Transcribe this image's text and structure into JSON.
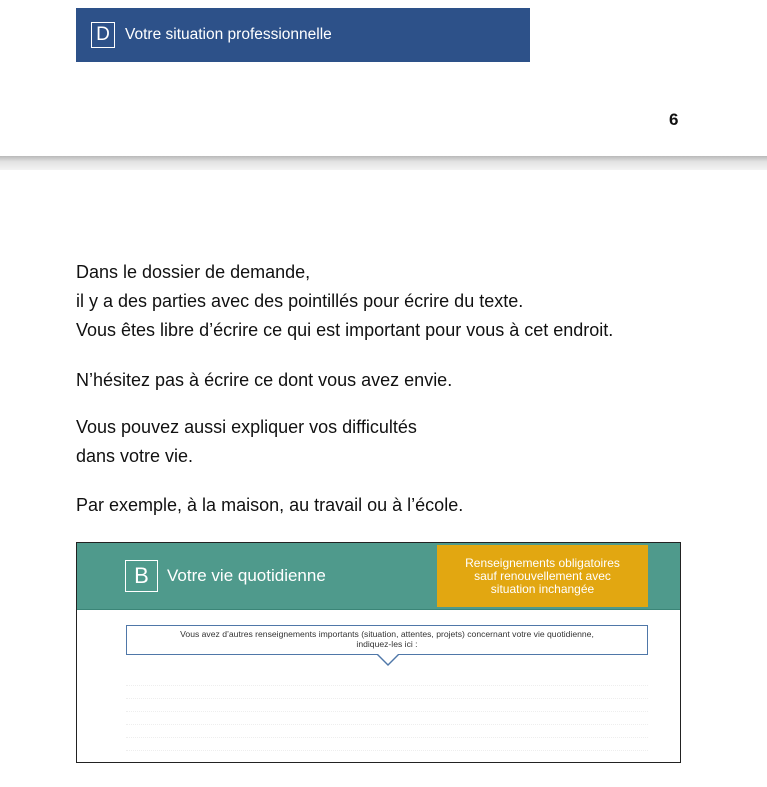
{
  "section_d": {
    "letter": "D",
    "title": "Votre situation professionnelle"
  },
  "page_number": "6",
  "body": {
    "paragraph_1": [
      "Dans le dossier de demande,",
      "il y a des parties avec des pointillés pour écrire du texte.",
      "Vous êtes libre d’écrire ce qui est important pour vous à cet endroit."
    ],
    "paragraph_2": "N’hésitez pas à écrire ce dont vous avez envie.",
    "paragraph_3": [
      "Vous pouvez aussi expliquer vos difficultés",
      "dans votre vie."
    ],
    "paragraph_4": "Par exemple, à la maison, au travail ou à l’école."
  },
  "form_excerpt": {
    "letter": "B",
    "title": "Votre vie quotidienne",
    "badge": [
      "Renseignements obligatoires",
      "sauf renouvellement avec",
      "situation inchangée"
    ],
    "bubble": [
      "Vous avez d’autres renseignements importants (situation, attentes, projets) concernant votre vie quotidienne,",
      "indiquez-les ici :"
    ]
  },
  "colors": {
    "section_d_blue": "#2d5189",
    "form_header_green": "#4f9a8c",
    "badge_yellow": "#e2a711",
    "bubble_border": "#4f77a8"
  }
}
